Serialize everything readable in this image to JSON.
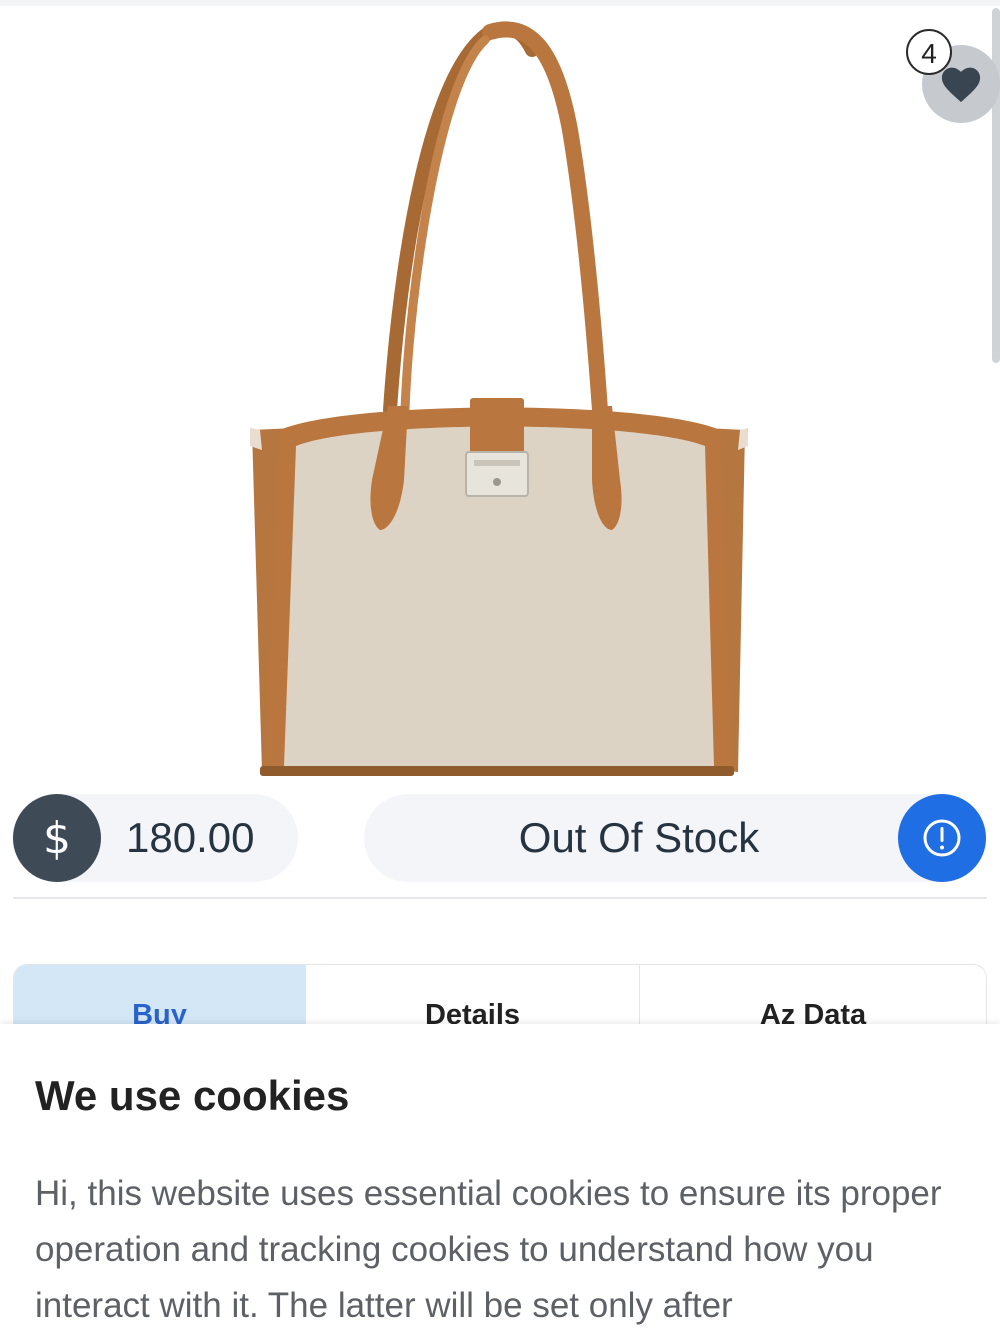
{
  "product": {
    "image_alt": "tote-bag",
    "wishlist_count": "4"
  },
  "price": {
    "currency_symbol": "$",
    "value": "180.00"
  },
  "stock": {
    "status": "Out Of Stock"
  },
  "tabs": [
    {
      "label": "Buy",
      "active": true
    },
    {
      "label": "Details",
      "active": false
    },
    {
      "label": "Az Data",
      "active": false
    }
  ],
  "cookie_banner": {
    "title": "We use cookies",
    "text": "Hi, this website uses essential cookies to ensure its proper operation and tracking cookies to understand how you interact with it. The latter will be set only after"
  },
  "colors": {
    "accent_blue": "#1f6ee3",
    "active_tab_bg": "#d3e7f7",
    "currency_circle": "#3f4a57",
    "strap_tan": "#b9773f",
    "canvas_beige": "#ddd3c4"
  }
}
